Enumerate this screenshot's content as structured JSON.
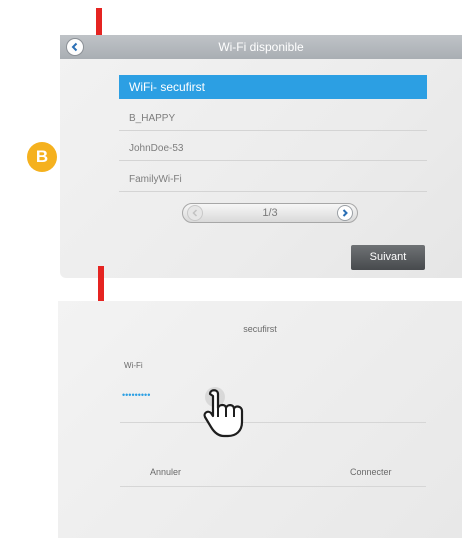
{
  "screen1": {
    "title": "Wi-Fi disponible",
    "networks": [
      "WiFi- secufirst",
      "B_HAPPY",
      "JohnDoe-53",
      "FamilyWi-Fi"
    ],
    "selected_index": 0,
    "pagination": "1/3",
    "next_label": "Suivant"
  },
  "badge_label": "B",
  "screen2": {
    "ssid": "secufirst",
    "wifi_label": "Wi-Fi",
    "password_value": "•••••••••",
    "cancel_label": "Annuler",
    "connect_label": "Connecter"
  },
  "colors": {
    "accent": "#2c9fe3",
    "arrow": "#e52421",
    "badge": "#f5b11e"
  },
  "icons": [
    "back-chevron-icon",
    "chevron-left-icon",
    "chevron-right-icon",
    "pointer-hand-icon",
    "down-arrow-icon"
  ]
}
